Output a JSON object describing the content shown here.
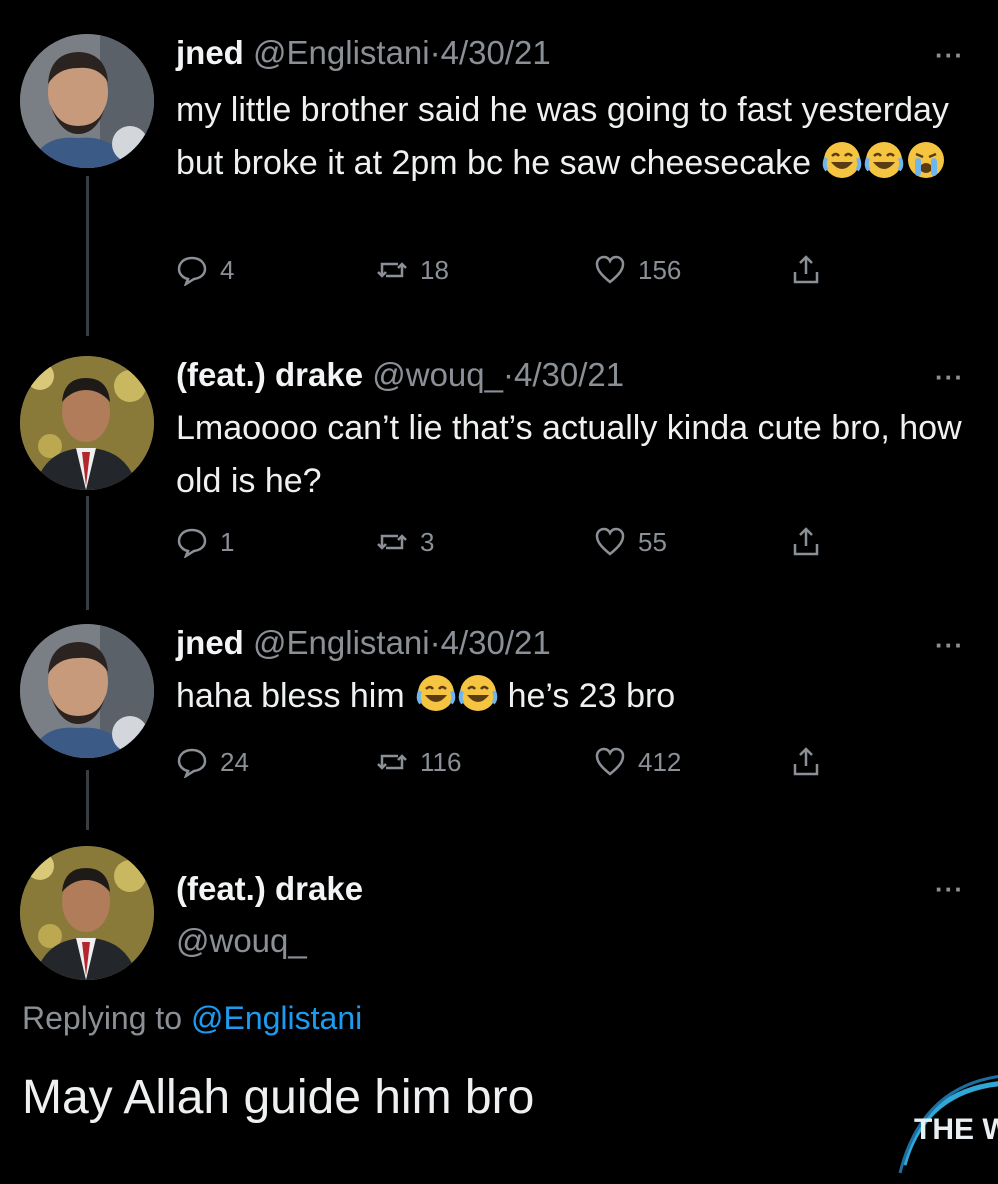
{
  "tweets": [
    {
      "name": "jned",
      "handle": "@Englistani",
      "separator": "·",
      "date": "4/30/21",
      "text": "my little brother said he was going to fast yesterday but broke it at 2pm bc he saw cheesecake",
      "emojis": [
        "joy-emoji",
        "joy-emoji",
        "sob-emoji"
      ],
      "replies": "4",
      "retweets": "18",
      "likes": "156"
    },
    {
      "name": "(feat.) drake",
      "handle": "@wouq_",
      "separator": "·",
      "date": "4/30/21",
      "text": "Lmaoooo can’t lie that’s actually kinda cute bro, how old is he?",
      "replies": "1",
      "retweets": "3",
      "likes": "55"
    },
    {
      "name": "jned",
      "handle": "@Englistani",
      "separator": "·",
      "date": "4/30/21",
      "text_before": "haha bless him",
      "text_after": "he’s 23 bro",
      "emojis": [
        "joy-emoji",
        "joy-emoji"
      ],
      "replies": "24",
      "retweets": "116",
      "likes": "412"
    }
  ],
  "final_tweet": {
    "name": "(feat.) drake",
    "handle": "@wouq_",
    "replying_prefix": "Replying to ",
    "replying_mention": "@Englistani",
    "text": "May Allah guide him bro"
  },
  "more_label": "···",
  "watermark_text": "THE W",
  "colors": {
    "background": "#000000",
    "secondary_text": "#8b9096",
    "mention_blue": "#1d9bf0",
    "thread_line": "#3a3d40"
  }
}
